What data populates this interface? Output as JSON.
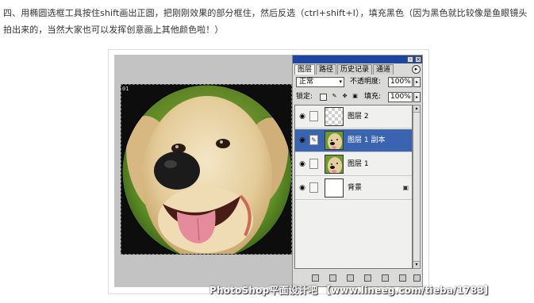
{
  "instruction": {
    "text": "四、用椭圆选框工具按住shift画出正圆，把刚刚效果的部分框住，然后反选（ctrl+shift+I），填充黑色（因为黑色就比较像是鱼眼镜头拍出来的，当然大家也可以发挥创意画上其他颜色啦！）"
  },
  "canvas": {
    "tag": "01"
  },
  "layers_panel": {
    "window_buttons": [
      "-",
      "×"
    ],
    "tabs": [
      {
        "label": "图层",
        "active": true
      },
      {
        "label": "路径",
        "active": false
      },
      {
        "label": "历史记录",
        "active": false
      },
      {
        "label": "通道",
        "active": false
      }
    ],
    "tab_menu_icon": "▸",
    "blend_mode": "正常",
    "opacity_label": "不透明度:",
    "opacity_value": "100%",
    "lock_label": "锁定:",
    "fill_label": "填充:",
    "fill_value": "100%",
    "layers": [
      {
        "name": "图层 2",
        "visible": true,
        "selected": false,
        "thumb": "transparent"
      },
      {
        "name": "图层 1 副本",
        "visible": true,
        "selected": true,
        "thumb": "dog"
      },
      {
        "name": "图层 1",
        "visible": true,
        "selected": false,
        "thumb": "dog"
      },
      {
        "name": "背景",
        "visible": true,
        "selected": false,
        "thumb": "white",
        "locked": true
      }
    ],
    "eye_icon": "👁",
    "brush_icon": "🖌",
    "lock_icon": "🔒",
    "selected_color": "#3a64b0"
  },
  "watermark": {
    "text": "PhotoShop平面设计吧 【www.lineeg.com/tieba/1783】"
  }
}
